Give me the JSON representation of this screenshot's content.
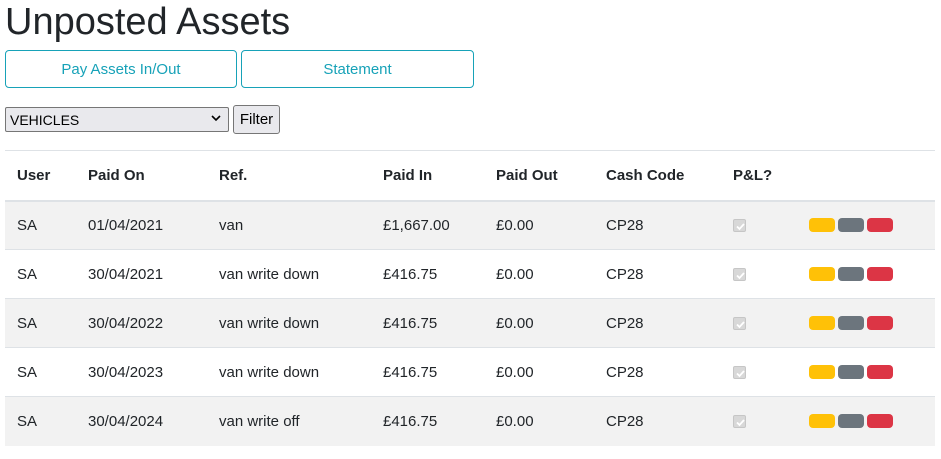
{
  "page": {
    "title": "Unposted Assets"
  },
  "toolbar": {
    "pay_label": "Pay Assets In/Out",
    "statement_label": "Statement"
  },
  "filter": {
    "selected": "VEHICLES",
    "button_label": "Filter"
  },
  "colors": {
    "accent": "#17a2b8",
    "edit": "#ffc107",
    "view": "#6c757d",
    "delete": "#dc3545",
    "stripe": "#f2f2f2"
  },
  "table": {
    "headers": [
      "User",
      "Paid On",
      "Ref.",
      "Paid In",
      "Paid Out",
      "Cash Code",
      "P&L?",
      ""
    ],
    "rows": [
      {
        "user": "SA",
        "paid_on": "01/04/2021",
        "ref": "van",
        "paid_in": "£1,667.00",
        "paid_out": "£0.00",
        "cash_code": "CP28",
        "pl": true
      },
      {
        "user": "SA",
        "paid_on": "30/04/2021",
        "ref": "van write down",
        "paid_in": "£416.75",
        "paid_out": "£0.00",
        "cash_code": "CP28",
        "pl": true
      },
      {
        "user": "SA",
        "paid_on": "30/04/2022",
        "ref": "van write down",
        "paid_in": "£416.75",
        "paid_out": "£0.00",
        "cash_code": "CP28",
        "pl": true
      },
      {
        "user": "SA",
        "paid_on": "30/04/2023",
        "ref": "van write down",
        "paid_in": "£416.75",
        "paid_out": "£0.00",
        "cash_code": "CP28",
        "pl": true
      },
      {
        "user": "SA",
        "paid_on": "30/04/2024",
        "ref": "van write off",
        "paid_in": "£416.75",
        "paid_out": "£0.00",
        "cash_code": "CP28",
        "pl": true
      }
    ]
  }
}
